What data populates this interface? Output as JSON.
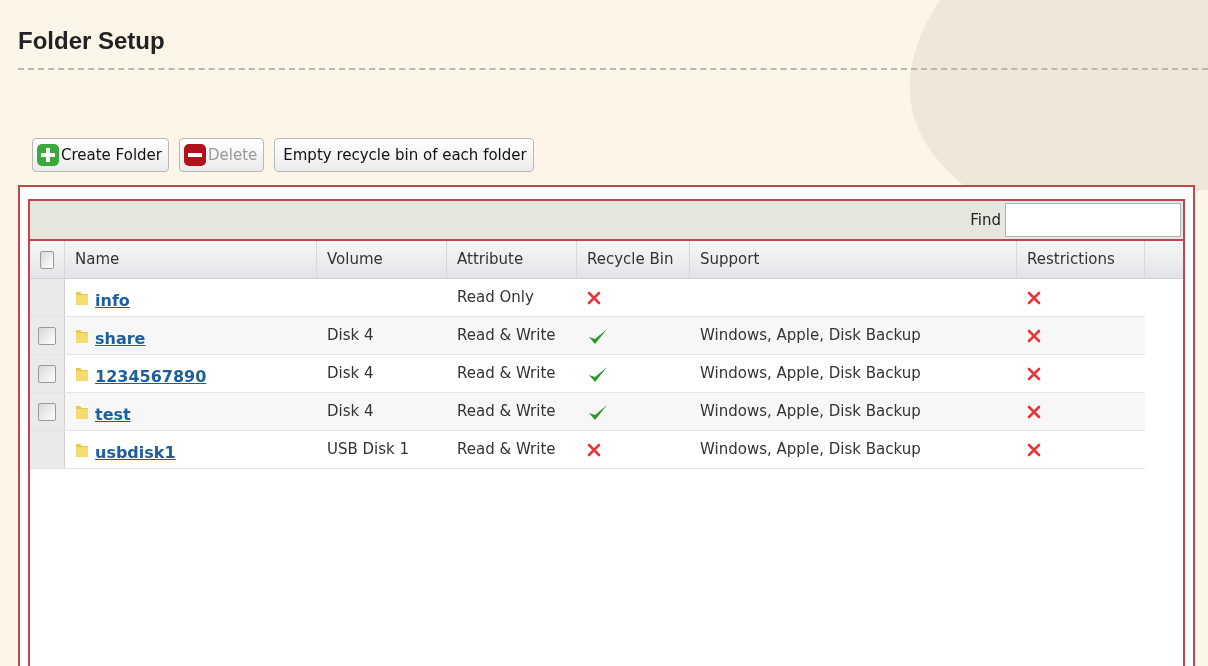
{
  "title": "Folder Setup",
  "toolbar": [
    {
      "label": "Create Folder",
      "kind": "create",
      "disabled": false
    },
    {
      "label": "Delete",
      "kind": "delete",
      "disabled": true
    },
    {
      "label": "Empty recycle bin of each folder",
      "kind": "plain",
      "disabled": false
    }
  ],
  "find": {
    "label": "Find"
  },
  "table": {
    "header_checkbox": {
      "checked": false
    },
    "columns": [
      "Name",
      "Volume",
      "Attribute",
      "Recycle Bin",
      "Support",
      "Restrictions"
    ],
    "rows": [
      {
        "selectable": false,
        "name": "info",
        "volume": "",
        "attribute": "Read Only",
        "recycle_bin": false,
        "support": "",
        "restricted": false
      },
      {
        "selectable": true,
        "name": "share",
        "volume": "Disk 4",
        "attribute": "Read & Write",
        "recycle_bin": true,
        "support": "Windows, Apple, Disk Backup",
        "restricted": false
      },
      {
        "selectable": true,
        "name": "1234567890",
        "volume": "Disk 4",
        "attribute": "Read & Write",
        "recycle_bin": true,
        "support": "Windows, Apple, Disk Backup",
        "restricted": false
      },
      {
        "selectable": true,
        "name": "test",
        "volume": "Disk 4",
        "attribute": "Read & Write",
        "recycle_bin": true,
        "support": "Windows, Apple, Disk Backup",
        "restricted": false
      },
      {
        "selectable": false,
        "name": "usbdisk1",
        "volume": "USB Disk 1",
        "attribute": "Read & Write",
        "recycle_bin": false,
        "support": "Windows, Apple, Disk Backup",
        "restricted": false
      }
    ]
  }
}
